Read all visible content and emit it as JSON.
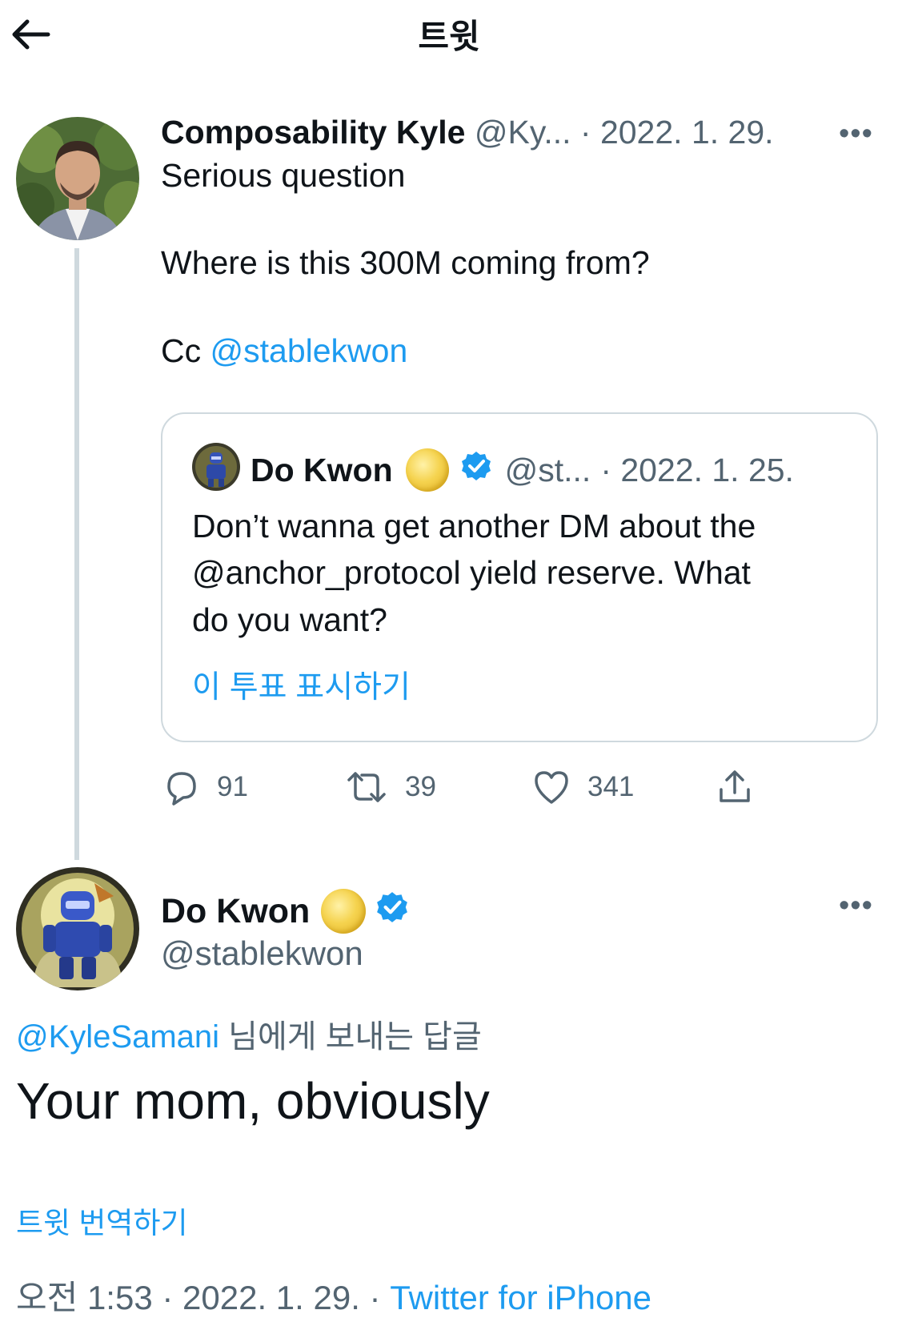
{
  "header": {
    "title": "트윗"
  },
  "kyle_tweet": {
    "display_name": "Composability Kyle",
    "handle": "@Ky...",
    "date": "· 2022. 1. 29.",
    "line1": "Serious question",
    "line2": "Where is this 300M coming from?",
    "line3_prefix": "Cc ",
    "line3_mention": "@stablekwon",
    "quoted": {
      "display_name": "Do Kwon",
      "handle": "@st...",
      "date": "· 2022. 1. 25.",
      "line1": "Don’t wanna get another DM about the",
      "line2": "@anchor_protocol yield reserve. What",
      "line3": "do you want?",
      "show_poll": "이 투표 표시하기"
    },
    "actions": {
      "replies": "91",
      "retweets": "39",
      "likes": "341"
    }
  },
  "reply_tweet": {
    "display_name": "Do Kwon",
    "handle": "@stablekwon",
    "replying_mention": "@KyleSamani",
    "replying_suffix": " 님에게 보내는 답글",
    "text": "Your mom, obviously",
    "translate": "트윗 번역하기",
    "time": "오전 1:53 · 2022. 1. 29. · ",
    "source": "Twitter for iPhone"
  },
  "colors": {
    "link": "#1d9bf0",
    "secondary": "#536471",
    "border": "#cfd9de"
  }
}
